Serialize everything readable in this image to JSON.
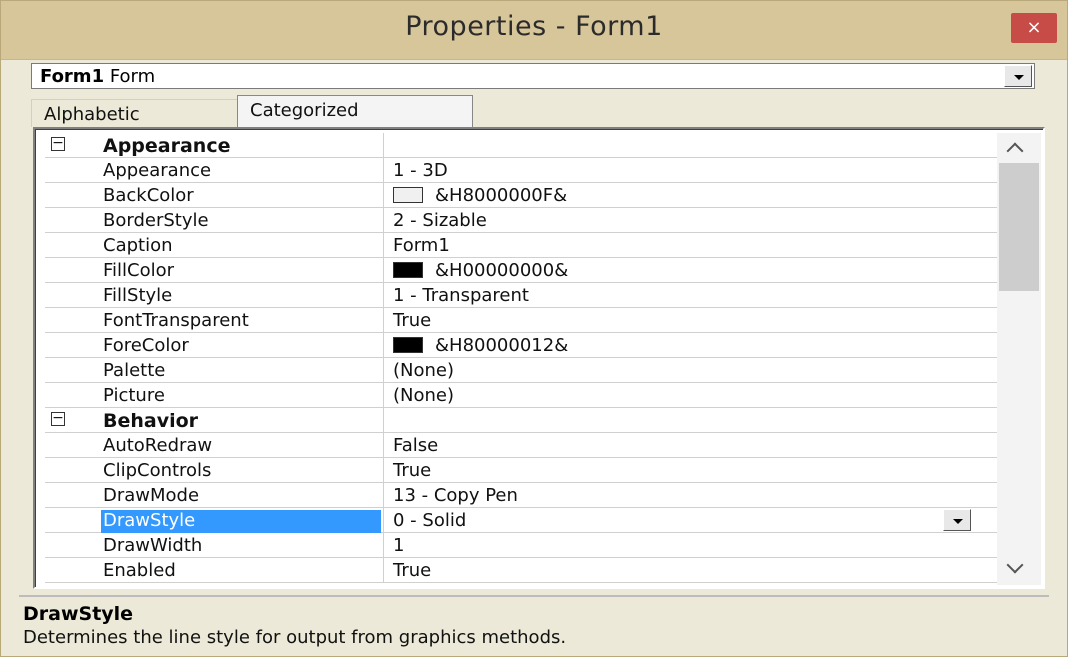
{
  "window": {
    "title": "Properties - Form1",
    "close_glyph": "×"
  },
  "object_selector": {
    "name": "Form1",
    "type": "Form"
  },
  "tabs": [
    {
      "label": "Alphabetic",
      "active": false
    },
    {
      "label": "Categorized",
      "active": true
    }
  ],
  "rows": [
    {
      "kind": "category",
      "expander": "−",
      "name": "Appearance",
      "value": ""
    },
    {
      "kind": "prop",
      "name": "Appearance",
      "value": "1 - 3D"
    },
    {
      "kind": "prop",
      "name": "BackColor",
      "value": "&H8000000F&",
      "swatch": "#f0f0f0"
    },
    {
      "kind": "prop",
      "name": "BorderStyle",
      "value": "2 - Sizable"
    },
    {
      "kind": "prop",
      "name": "Caption",
      "value": "Form1"
    },
    {
      "kind": "prop",
      "name": "FillColor",
      "value": "&H00000000&",
      "swatch": "#000000"
    },
    {
      "kind": "prop",
      "name": "FillStyle",
      "value": "1 - Transparent"
    },
    {
      "kind": "prop",
      "name": "FontTransparent",
      "value": "True"
    },
    {
      "kind": "prop",
      "name": "ForeColor",
      "value": "&H80000012&",
      "swatch": "#000000"
    },
    {
      "kind": "prop",
      "name": "Palette",
      "value": "(None)"
    },
    {
      "kind": "prop",
      "name": "Picture",
      "value": "(None)"
    },
    {
      "kind": "category",
      "expander": "−",
      "name": "Behavior",
      "value": ""
    },
    {
      "kind": "prop",
      "name": "AutoRedraw",
      "value": "False"
    },
    {
      "kind": "prop",
      "name": "ClipControls",
      "value": "True"
    },
    {
      "kind": "prop",
      "name": "DrawMode",
      "value": "13 - Copy Pen"
    },
    {
      "kind": "prop",
      "name": "DrawStyle",
      "value": "0 - Solid",
      "selected": true,
      "dropdown": true
    },
    {
      "kind": "prop",
      "name": "DrawWidth",
      "value": "1"
    },
    {
      "kind": "prop",
      "name": "Enabled",
      "value": "True"
    }
  ],
  "description": {
    "heading": "DrawStyle",
    "text": "Determines the line style for output from graphics methods."
  },
  "colors": {
    "selection": "#3399ff",
    "titlebar": "#d8c69b",
    "close": "#c74c48"
  }
}
